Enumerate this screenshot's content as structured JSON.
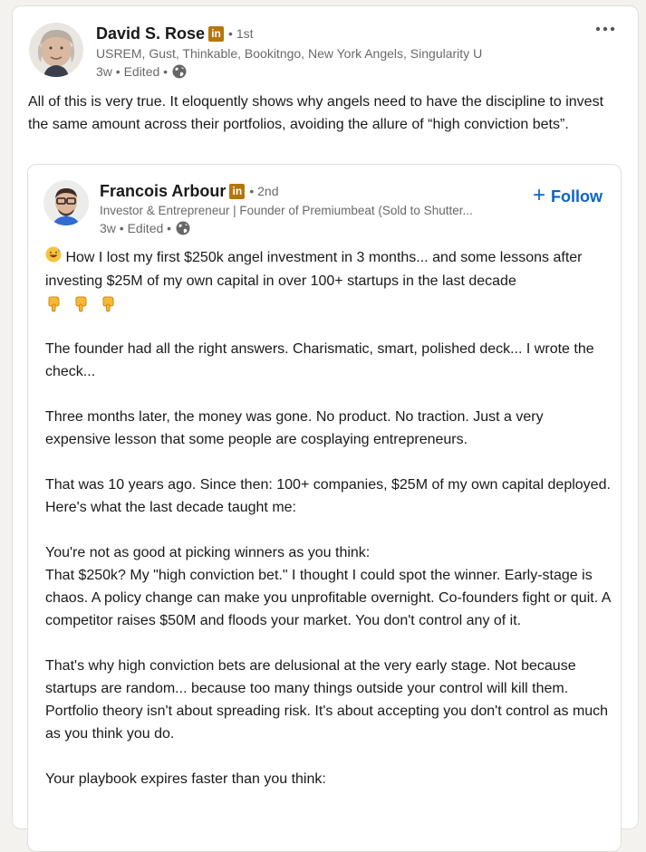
{
  "post": {
    "author": {
      "name": "David S. Rose",
      "badge": "in",
      "degree": "• 1st",
      "headline": "USREM, Gust, Thinkable, Bookitngo, New York Angels, Singularity U",
      "time": "3w • Edited •"
    },
    "commentary": "All of this is very true. It eloquently shows why angels need to have the discipline to invest the same amount across their portfolios, avoiding the allure of “high conviction bets”."
  },
  "reshared": {
    "author": {
      "name": "Francois Arbour",
      "badge": "in",
      "degree": "• 2nd",
      "headline": "Investor & Entrepreneur | Founder of Premiumbeat (Sold to Shutter...",
      "time": "3w • Edited •"
    },
    "follow_label": "Follow",
    "lines": {
      "l1": "How I lost my first $250k angel investment in 3 months... and some lessons after investing $25M of my own capital in over 100+ startups in the last decade",
      "p2": "The founder had all the right answers. Charismatic, smart, polished deck... I wrote the check...",
      "p3": "Three months later, the money was gone. No product. No traction. Just a very expensive lesson that some people are cosplaying entrepreneurs.",
      "p4": "That was 10 years ago. Since then: 100+ companies, $25M of my own capital deployed. Here's what the last decade taught me:",
      "p5a": "You're not as good at picking winners as you think:",
      "p5b": "That $250k? My \"high conviction bet.\" I thought I could spot the winner. Early-stage is chaos. A policy change can make you unprofitable overnight. Co-founders fight or quit. A competitor raises $50M and floods your market. You don't control any of it.",
      "p6": "That's why high conviction bets are delusional at the very early stage. Not because startups are random... because too many things outside your control will kill them. Portfolio theory isn't about spreading risk. It's about accepting you don't control as much as you think you do.",
      "p7": "Your playbook expires faster than you think:"
    }
  },
  "icons": {
    "more": "more-horizontal-icon",
    "globe": "globe-icon",
    "sweat_emoji": "grinning-sweat-emoji",
    "pointing_emoji": "backhand-index-pointing-down-emoji"
  },
  "colors": {
    "accent": "#0a66c2",
    "badge": "#b4770e"
  }
}
